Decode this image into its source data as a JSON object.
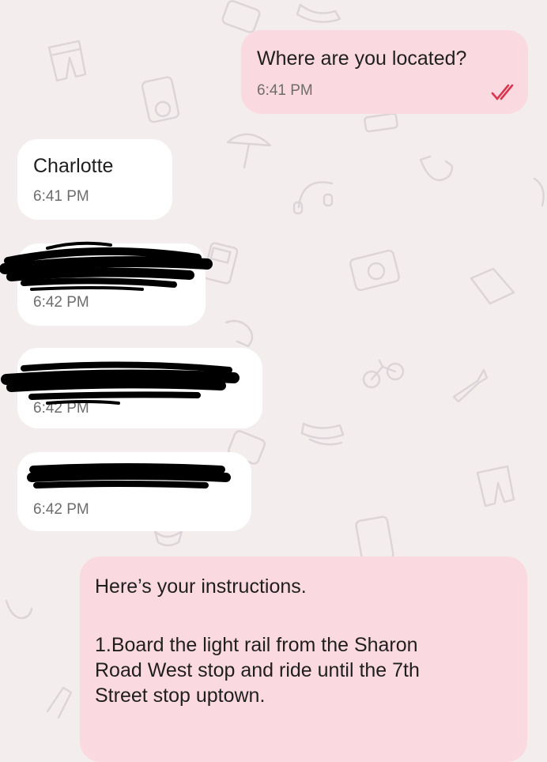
{
  "chat": {
    "messages": [
      {
        "id": "m1",
        "direction": "outgoing",
        "text": "Where are you located?",
        "time": "6:41 PM",
        "status_icon": "read-double-check-icon"
      },
      {
        "id": "m2",
        "direction": "incoming",
        "text": "Charlotte",
        "time": "6:41 PM"
      },
      {
        "id": "m3",
        "direction": "incoming",
        "text_redacted": true,
        "time": "6:42 PM"
      },
      {
        "id": "m4",
        "direction": "incoming",
        "text_redacted": true,
        "time": "6:42 PM"
      },
      {
        "id": "m5",
        "direction": "incoming",
        "text_redacted": true,
        "time": "6:42 PM"
      },
      {
        "id": "m6",
        "direction": "outgoing",
        "line1": "Here’s your instructions.",
        "step1": "1.Board the light rail from the Sharon\nRoad West stop and ride until the 7th\nStreet stop uptown."
      }
    ]
  },
  "colors": {
    "outgoing_bubble": "#fbd9e0",
    "incoming_bubble": "#ffffff",
    "background": "#f3edee",
    "read_check": "#d9364f",
    "redaction": "#000000"
  },
  "background_doodles": [
    "pants-icon",
    "ipod-icon",
    "umbrella-icon",
    "saxophone-icon",
    "headphones-icon",
    "gameboy-icon",
    "camera-icon",
    "bicycle-icon",
    "trumpet-icon",
    "sneakers-icon",
    "robot-icon",
    "tablet-icon",
    "vinyl-record-icon"
  ]
}
